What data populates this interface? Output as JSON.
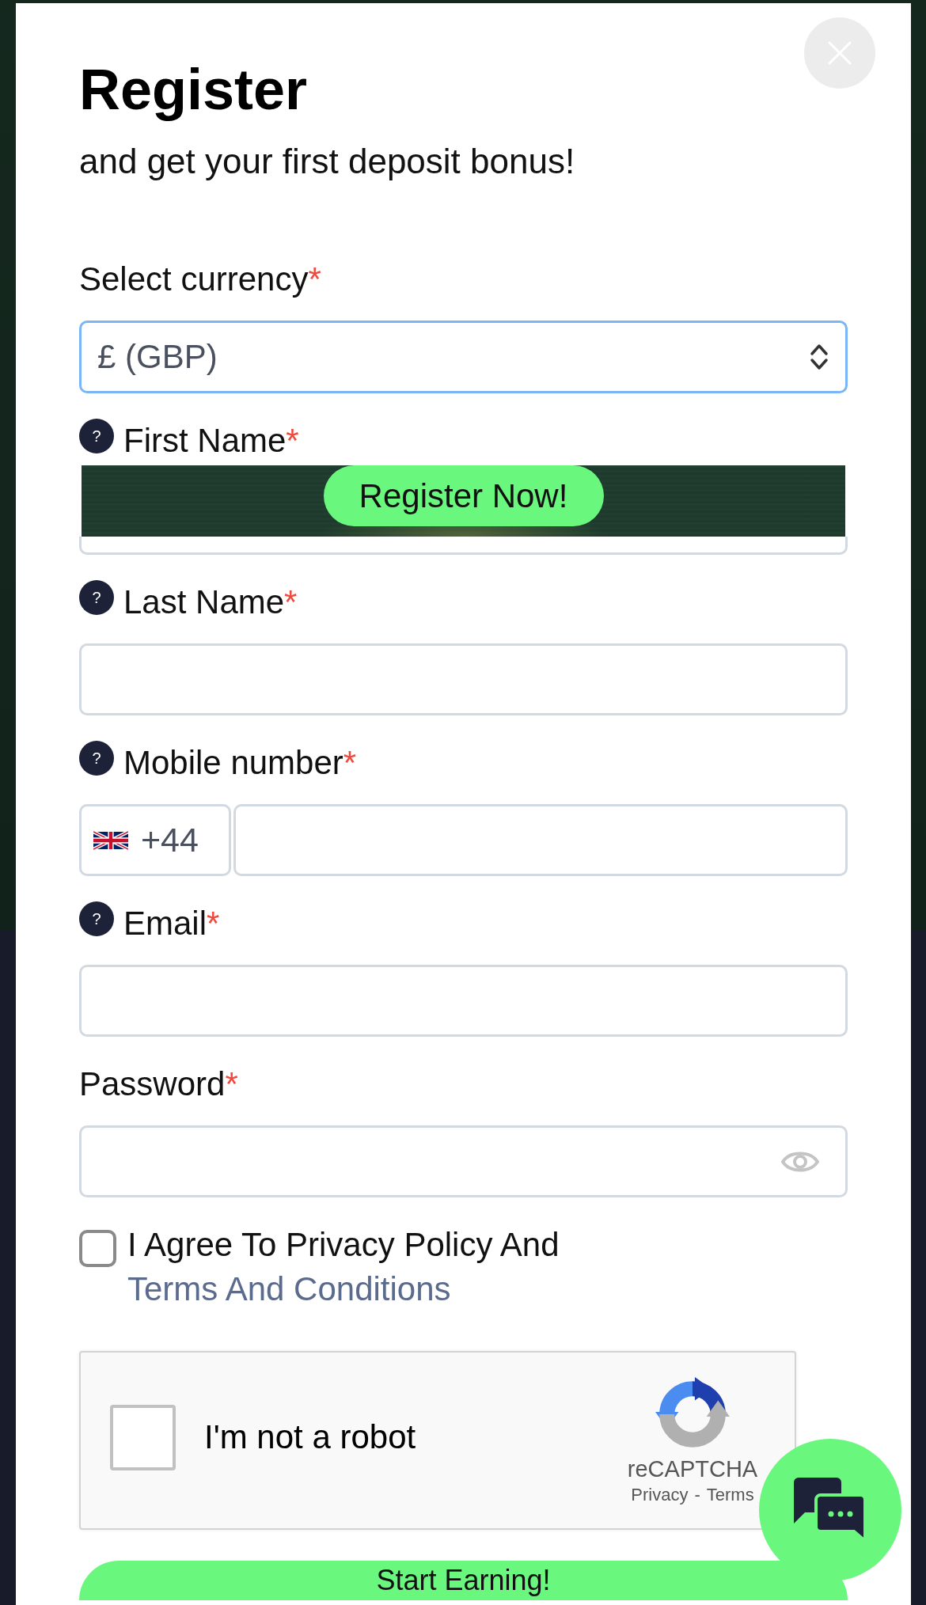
{
  "dialog": {
    "title": "Register",
    "subtitle": "and get your first deposit bonus!"
  },
  "fields": [
    {
      "kind": "select",
      "label": "Select currency",
      "required_mark": "*",
      "value": "£ (GBP)",
      "focused": true
    },
    {
      "kind": "text",
      "label": "First Name",
      "required_mark": "*",
      "help": "?",
      "focused": false,
      "overlay_banner": {
        "button": "Register Now!"
      }
    },
    {
      "kind": "text",
      "label": "Last Name",
      "required_mark": "*",
      "help": "?",
      "focused": false
    },
    {
      "kind": "phone",
      "label": "Mobile number",
      "required_mark": "*",
      "help": "?",
      "country_code": "+44",
      "focused": false
    },
    {
      "kind": "text",
      "label": "Email",
      "required_mark": "*",
      "help": "?",
      "focused": false
    },
    {
      "kind": "password",
      "label": "Password",
      "required_mark": "*",
      "focused": false
    }
  ],
  "agreement": {
    "checked": false,
    "text": "I Agree To Privacy Policy And",
    "link": "Terms And Conditions"
  },
  "captcha": {
    "checked": false,
    "label": "I'm not a robot",
    "brand": "reCAPTCHA",
    "privacy_link": "Privacy",
    "separator": "-",
    "terms_link": "Terms"
  },
  "submit_button": {
    "label": "Start Earning!"
  }
}
